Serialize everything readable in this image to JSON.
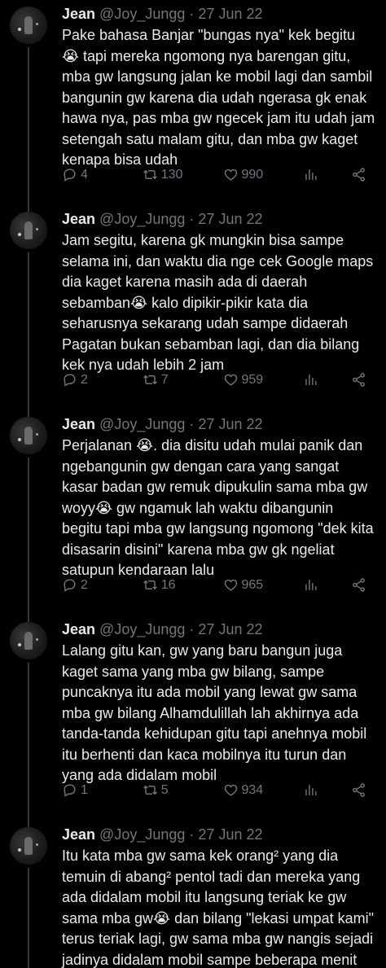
{
  "tweets": [
    {
      "name": "Jean",
      "handle": "@Joy_Jungg",
      "separator": "·",
      "date": "27 Jun 22",
      "text": "Pake bahasa Banjar \"bungas nya\" kek begitu 😭 tapi mereka ngomong nya barengan gitu, mba gw langsung jalan ke mobil lagi dan sambil bangunin gw karena dia udah ngerasa gk enak hawa nya, pas mba gw ngecek jam itu udah jam setengah satu malam gitu, dan mba gw kaget kenapa bisa udah",
      "replies": "4",
      "retweets": "130",
      "likes": "990"
    },
    {
      "name": "Jean",
      "handle": "@Joy_Jungg",
      "separator": "·",
      "date": "27 Jun 22",
      "text": "Jam segitu, karena gk mungkin bisa sampe selama ini, dan waktu dia nge cek Google maps dia kaget karena masih ada di daerah sebamban😭 kalo dipikir-pikir kata dia seharusnya sekarang udah sampe didaerah Pagatan bukan sebamban lagi, dan dia bilang kek nya udah lebih 2 jam",
      "replies": "2",
      "retweets": "7",
      "likes": "959"
    },
    {
      "name": "Jean",
      "handle": "@Joy_Jungg",
      "separator": "·",
      "date": "27 Jun 22",
      "text": "Perjalanan 😭. dia disitu udah mulai panik dan ngebangunin gw dengan cara yang sangat kasar badan gw remuk dipukulin sama mba gw woyy😭 gw ngamuk lah waktu dibangunin begitu tapi mba gw langsung ngomong \"dek kita disasarin disini\" karena mba gw gk ngeliat satupun kendaraan lalu",
      "replies": "2",
      "retweets": "16",
      "likes": "965"
    },
    {
      "name": "Jean",
      "handle": "@Joy_Jungg",
      "separator": "·",
      "date": "27 Jun 22",
      "text": "Lalang gitu kan, gw yang baru bangun juga kaget sama yang mba gw bilang, sampe puncaknya itu ada mobil yang lewat gw sama mba gw bilang Alhamdulillah lah akhirnya ada tanda-tanda kehidupan gitu tapi anehnya mobil itu berhenti dan kaca mobilnya itu turun dan yang ada didalam mobil",
      "replies": "1",
      "retweets": "5",
      "likes": "934"
    },
    {
      "name": "Jean",
      "handle": "@Joy_Jungg",
      "separator": "·",
      "date": "27 Jun 22",
      "text": "Itu kata mba gw sama kek orang² yang dia temuin di abang² pentol tadi dan mereka yang ada didalam mobil itu langsung teriak ke gw sama mba gw😭 dan bilang \"lekasi umpat kami\" terus teriak lagi, gw sama mba gw nangis sejadi jadinya didalam mobil sampe beberapa menit kemudian emak"
    }
  ],
  "icons": {
    "reply": "reply-icon",
    "retweet": "retweet-icon",
    "like": "heart-icon",
    "views": "views-icon",
    "share": "share-icon"
  },
  "colors": {
    "background": "#000000",
    "text": "#e7e9ea",
    "muted": "#71767b",
    "thread_line": "#333639"
  }
}
